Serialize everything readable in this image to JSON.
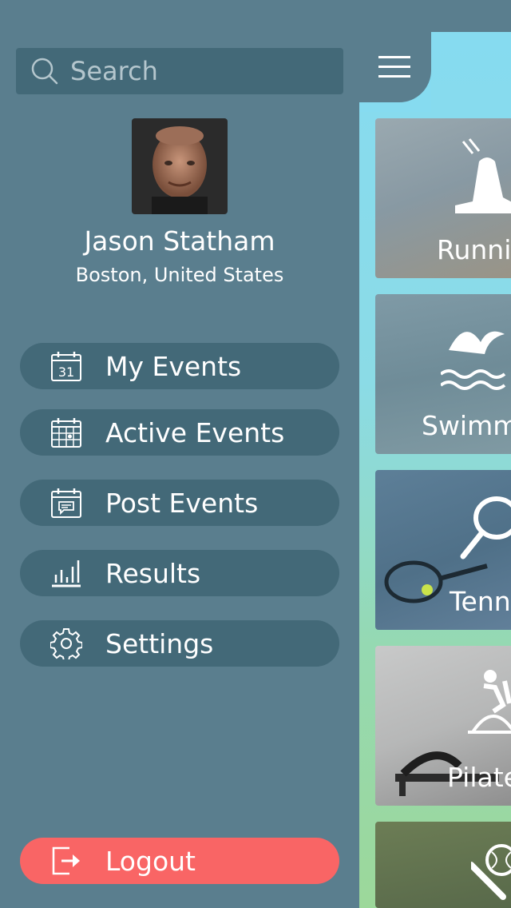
{
  "search": {
    "placeholder": "Search"
  },
  "user": {
    "name": "Jason Statham",
    "location": "Boston, United States"
  },
  "menu": [
    {
      "label": "My Events",
      "icon": "calendar-31-icon"
    },
    {
      "label": "Active Events",
      "icon": "calendar-grid-icon"
    },
    {
      "label": "Post Events",
      "icon": "calendar-post-icon"
    },
    {
      "label": "Results",
      "icon": "bar-chart-icon"
    },
    {
      "label": "Settings",
      "icon": "gear-icon"
    }
  ],
  "logout": {
    "label": "Logout",
    "icon": "logout-icon"
  },
  "cards": [
    {
      "label": "Runni",
      "icon": "running-shoe-icon"
    },
    {
      "label": "Swimm",
      "icon": "swimmer-icon"
    },
    {
      "label": "Tenn",
      "icon": "tennis-racket-icon"
    },
    {
      "label": "Pilate",
      "icon": "exercise-bike-icon"
    },
    {
      "label": "",
      "icon": "baseball-icon"
    }
  ],
  "colors": {
    "sidebar": "#5a7e8e",
    "menu_pill": "#436978",
    "logout": "#f96565",
    "panel_top": "#86dbf0",
    "panel_bottom": "#9cd89a"
  }
}
